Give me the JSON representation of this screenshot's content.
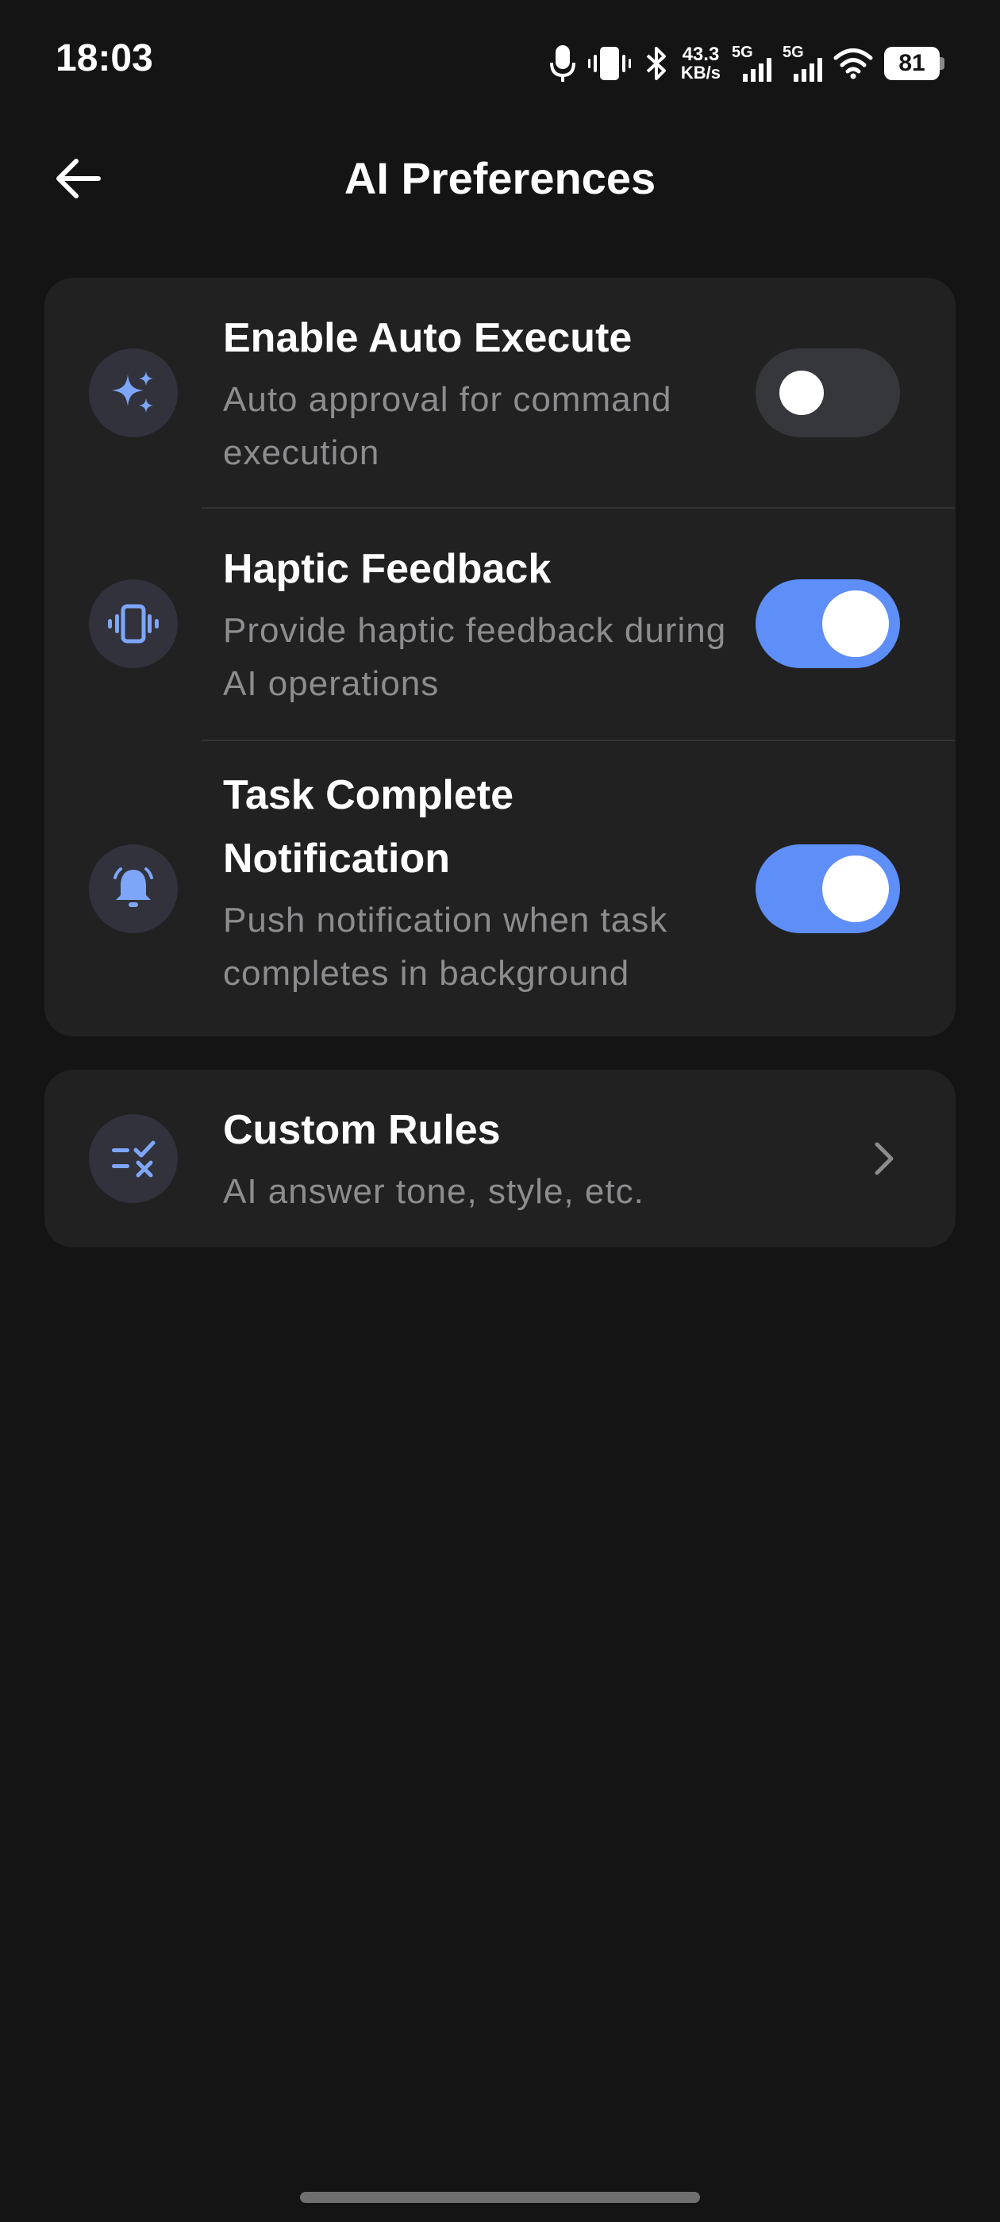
{
  "status_bar": {
    "time": "18:03",
    "net_speed_value": "43.3",
    "net_speed_unit": "KB/s",
    "signal_1_label": "5G",
    "signal_2_label": "5G",
    "battery_level": "81",
    "icons": [
      "microphone-icon",
      "vibrate-icon",
      "bluetooth-icon",
      "signal-icon",
      "wifi-icon",
      "battery-icon"
    ]
  },
  "header": {
    "title": "AI Preferences",
    "back_icon": "arrow-left-icon"
  },
  "settings": [
    {
      "title": "Enable Auto Execute",
      "description": "Auto approval for command execution",
      "icon": "sparkles-icon",
      "enabled": false
    },
    {
      "title": "Haptic Feedback",
      "description": "Provide haptic feedback during AI operations",
      "icon": "vibrate-icon",
      "enabled": true
    },
    {
      "title": "Task Complete Notification",
      "description": "Push notification when task completes in background",
      "icon": "bell-icon",
      "enabled": true
    }
  ],
  "custom_rules": {
    "title": "Custom Rules",
    "description": "AI answer tone, style, etc.",
    "icon": "rules-list-icon",
    "chevron_icon": "chevron-right-icon"
  },
  "colors": {
    "background": "#141414",
    "card": "#212122",
    "accent": "#5e8ef7",
    "icon_tint": "#7ea6f8",
    "toggle_off": "#36373b",
    "secondary_text": "#8d8d8f"
  }
}
